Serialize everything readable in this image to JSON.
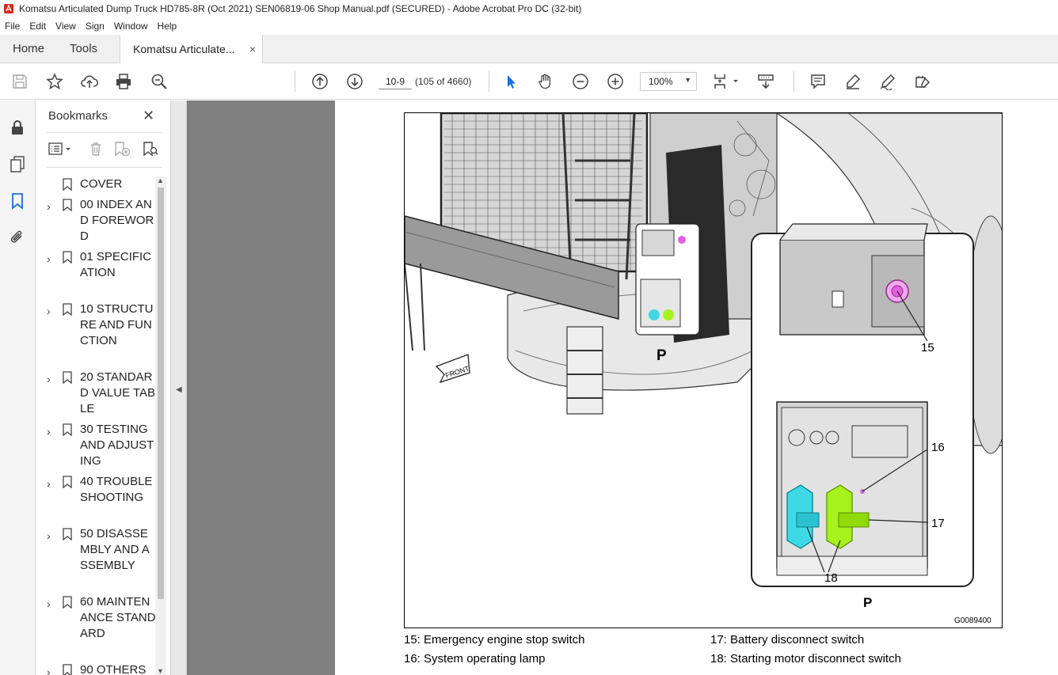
{
  "window": {
    "title": "Komatsu Articulated Dump Truck HD785-8R (Oct 2021) SEN06819-06 Shop Manual.pdf (SECURED) - Adobe Acrobat Pro DC (32-bit)"
  },
  "menu": [
    "File",
    "Edit",
    "View",
    "Sign",
    "Window",
    "Help"
  ],
  "tabs": {
    "home": "Home",
    "tools": "Tools",
    "document": "Komatsu Articulate...",
    "close": "×"
  },
  "toolbar": {
    "page_value": "10-9",
    "page_count": "(105 of 4660)",
    "zoom": "100%"
  },
  "bookmarks": {
    "title": "Bookmarks",
    "items": [
      {
        "label": "COVER",
        "expandable": false
      },
      {
        "label": "00 INDEX AND FOREWORD",
        "expandable": true
      },
      {
        "label": "01 SPECIFICATION",
        "expandable": true
      },
      {
        "label": "10 STRUCTURE AND FUNCTION",
        "expandable": true
      },
      {
        "label": "20 STANDARD VALUE TABLE",
        "expandable": true
      },
      {
        "label": "30 TESTING AND ADJUSTING",
        "expandable": true
      },
      {
        "label": "40 TROUBLESHOOTING",
        "expandable": true
      },
      {
        "label": "50 DISASSEMBLY AND ASSEMBLY",
        "expandable": true
      },
      {
        "label": "60 MAINTENANCE STANDARD",
        "expandable": true
      },
      {
        "label": "90 OTHERS",
        "expandable": true
      }
    ]
  },
  "figure": {
    "front_label": "FRONT",
    "view_label": "P",
    "detail_label": "P",
    "callouts": [
      "15",
      "16",
      "17",
      "18"
    ],
    "figure_id": "G0089400",
    "colors": {
      "switch18": "#3fd9e6",
      "switch17": "#a6f21c",
      "button15": "#e35ee0",
      "lamp16": "#d36ad6"
    }
  },
  "captions": {
    "c15": "15: Emergency engine stop switch",
    "c16": "16: System operating lamp",
    "c17": "17: Battery disconnect switch",
    "c18": "18: Starting motor disconnect switch"
  }
}
